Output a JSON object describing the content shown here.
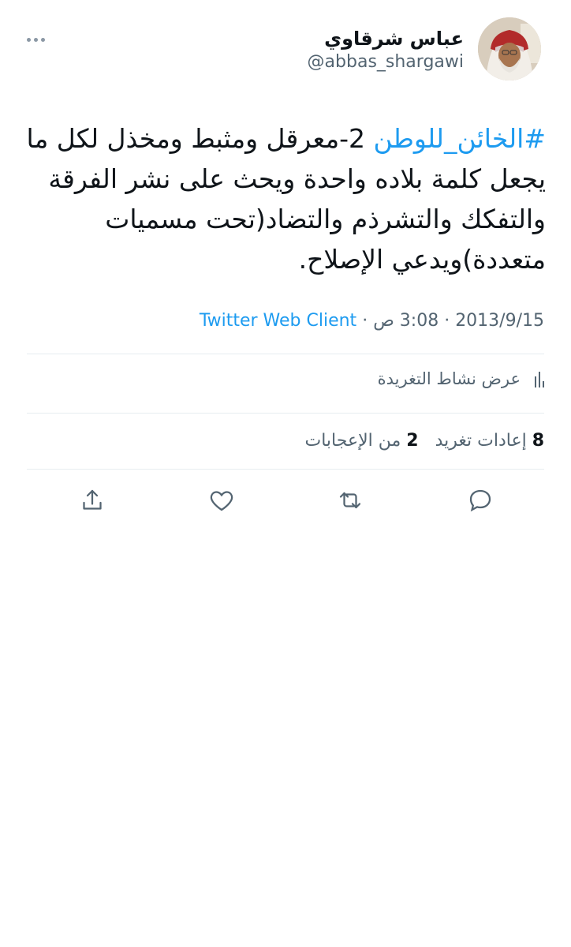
{
  "author": {
    "display_name": "عباس شرقاوي",
    "handle": "@abbas_shargawi"
  },
  "tweet": {
    "hashtag": "#الخائن_للوطن",
    "text_rest": " 2-معرقل ومثبط ومخذل لكل ما يجعل كلمة بلاده واحدة ويحث على نشر الفرقة والتفكك والتشرذم والتضاد(تحت مسميات متعددة)ويدعي الإصلاح."
  },
  "meta": {
    "date": "2013/9/15",
    "time": "3:08 ص",
    "separator": "·",
    "source": "Twitter Web Client"
  },
  "activity": {
    "label": "عرض نشاط التغريدة"
  },
  "stats": {
    "retweets_count": "8",
    "retweets_label": "إعادات تغريد",
    "likes_count": "2",
    "likes_label": "من الإعجابات"
  },
  "icons": {
    "more": "more-dots-icon",
    "reply": "reply-icon",
    "retweet": "retweet-icon",
    "like": "heart-icon",
    "share": "share-icon",
    "activity": "bar-chart-icon"
  },
  "colors": {
    "accent": "#1d9bf0",
    "text": "#0f1419",
    "secondary": "#536471",
    "divider": "#e6ecf0"
  }
}
